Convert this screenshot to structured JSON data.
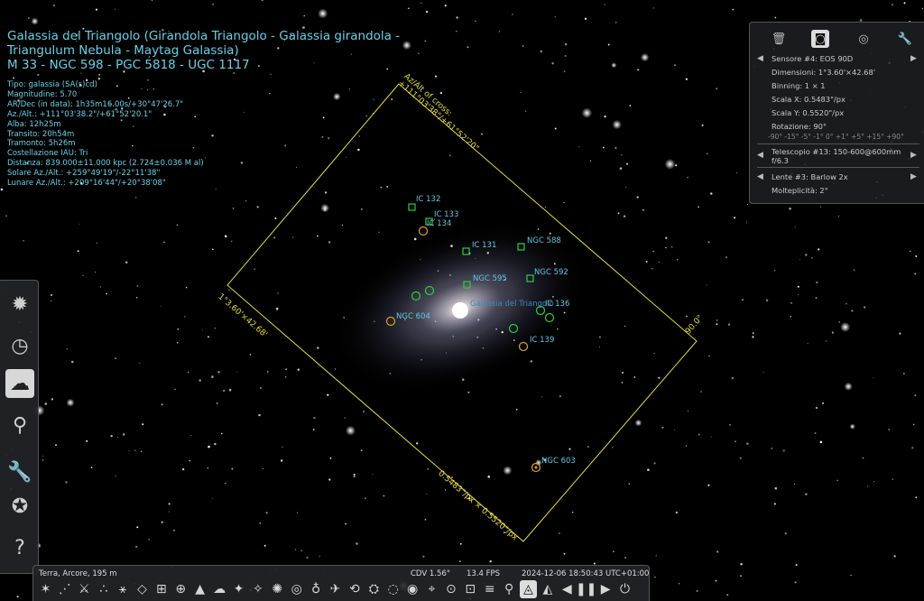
{
  "object_info": {
    "title_lines": [
      "Galassia del Triangolo (Girandola Triangolo - Galassia girandola -",
      "Triangulum Nebula - Maytag Galassia)",
      "M 33 - NGC 598 - PGC 5818 - UGC 1117"
    ],
    "details": [
      "Tipo: galassia (SA(s)cd)",
      "Magnitudine: 5.70",
      "AR/Dec (in data): 1h35m16.00s/+30°47'26.7\"",
      "Az./Alt.: +111°03'38.2\"/+61°52'20.1\"",
      "Alba: 12h25m",
      "Transito: 20h54m",
      "Tramonto: 5h26m",
      "Costellazione IAU: Tri",
      "Distanza: 839.000±11.000 kpc (2.724±0.036 M al)",
      "Solare Az./Alt.: +259°49'19\"/-22°11'38\"",
      "Lunare Az./Alt.: +209°16'44\"/+20°38'08\""
    ]
  },
  "sky_labels": [
    {
      "id": "ic132",
      "text": "IC 132"
    },
    {
      "id": "ic133",
      "text": "IC 133"
    },
    {
      "id": "ic134",
      "text": "IC 134"
    },
    {
      "id": "ic131",
      "text": "IC 131"
    },
    {
      "id": "ngc588",
      "text": "NGC 588"
    },
    {
      "id": "ngc592",
      "text": "NGC 592"
    },
    {
      "id": "ngc595",
      "text": "NGC 595"
    },
    {
      "id": "m33",
      "text": "Galassia del Triangolo"
    },
    {
      "id": "ic136",
      "text": "IC 136"
    },
    {
      "id": "ngc604",
      "text": "NGC 604"
    },
    {
      "id": "ic139",
      "text": "IC 139"
    },
    {
      "id": "ngc603",
      "text": "NGC 603"
    }
  ],
  "ocular_frame": {
    "azalt_line1": "Az/Alt of cross:",
    "azalt_line2": "+111°03'38\"/+61°52'20\"",
    "fov": "1°3.60'×42.68'",
    "rotation": "90.0°",
    "scale": "0.5483\"/px × 0.5520\"/px"
  },
  "oculars_panel": {
    "tabs": [
      "trash-icon",
      "camera-icon",
      "target-icon",
      "wrench-icon"
    ],
    "sensor": "Sensore #4: EOS 90D",
    "dimensions": "Dimensioni: 1°3.60'×42.68'",
    "binning": "Binning: 1 × 1",
    "scale_x": "Scala X: 0.5483\"/px",
    "scale_y": "Scala Y: 0.5520\"/px",
    "rotation": "Rotazione: 90°",
    "rotation_steps": "-90° -15° -5° -1° 0° +1° +5° +15° +90°",
    "telescope": "Telescopio #13: 150-600@600mm f/6.3",
    "lens": "Lente #3: Barlow 2x",
    "multiplicity": "Molteplicità: 2°"
  },
  "status_bar": {
    "location": "Terra, Arcore, 195 m",
    "fov": "CDV 1.56°",
    "fps": "13.4 FPS",
    "datetime": "2024-12-06 18:50:43 UTC+01:00"
  },
  "left_toolbar": [
    {
      "name": "sky-location-icon"
    },
    {
      "name": "clock-icon"
    },
    {
      "name": "sky-view-settings-icon"
    },
    {
      "name": "search-icon"
    },
    {
      "name": "configuration-icon"
    },
    {
      "name": "astrocalc-icon"
    },
    {
      "name": "help-icon"
    }
  ],
  "bottom_toolbar_glyphs": [
    "✶",
    "⋰",
    "⚔",
    "∴",
    "⚹",
    "◇",
    "⊞",
    "⊕",
    "▲",
    "☁",
    "✦",
    "✧",
    "✺",
    "◎",
    "♁",
    "✈",
    "⟲",
    "⛭",
    "◌",
    "◉",
    "⌖",
    "⊙",
    "⊡",
    "≡",
    "⚲",
    "◬",
    "◭",
    "◀",
    "❚❚",
    "▶",
    "⏻"
  ],
  "colors": {
    "info_text": "#6ad0e6",
    "frame": "#e8dc3c",
    "marker_green": "#2ecc40",
    "marker_orange": "#e0a020"
  }
}
